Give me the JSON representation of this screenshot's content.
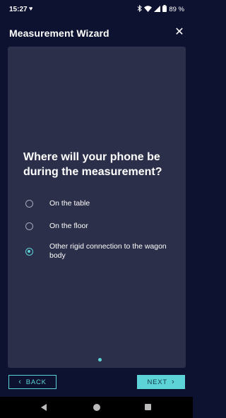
{
  "status_bar": {
    "time": "15:27",
    "battery": "89 %",
    "icons": [
      "heart-icon",
      "bluetooth-icon",
      "wifi-icon",
      "signal-icon",
      "battery-icon"
    ]
  },
  "header": {
    "title": "Measurement Wizard",
    "close_icon": "close-icon"
  },
  "question": "Where will your phone be during the measurement?",
  "options": [
    {
      "label": "On the table",
      "selected": false
    },
    {
      "label": "On the floor",
      "selected": false
    },
    {
      "label": "Other rigid connection to the wagon body",
      "selected": true
    }
  ],
  "pager": {
    "current": 1
  },
  "buttons": {
    "back": "BACK",
    "next": "NEXT"
  },
  "colors": {
    "background": "#0d1230",
    "card": "#2b2f49",
    "accent": "#5cd3d7"
  }
}
